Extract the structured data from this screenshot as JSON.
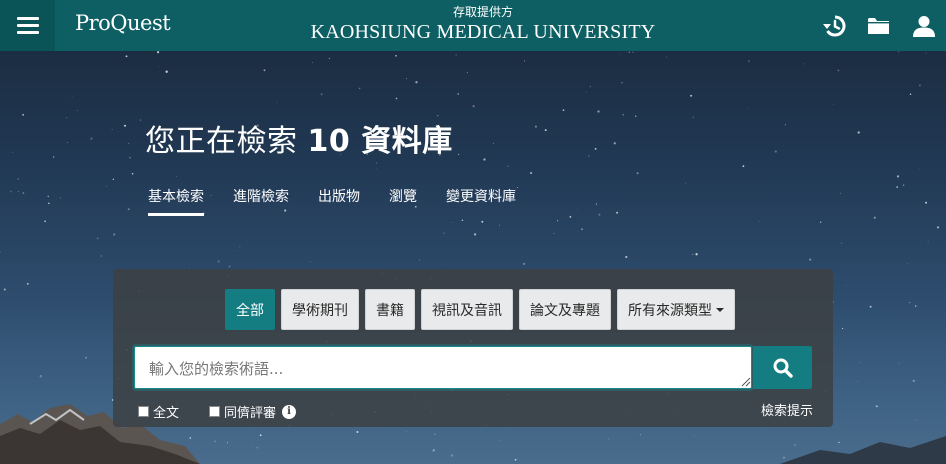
{
  "header": {
    "logo": "ProQuest",
    "provider_caption": "存取提供方",
    "provider_name": "KAOHSIUNG MEDICAL UNIVERSITY",
    "icons": [
      "menu-icon",
      "history-icon",
      "folder-icon",
      "user-icon"
    ]
  },
  "hero": {
    "title_prefix": "您正在檢索 ",
    "title_bold": "10 資料庫"
  },
  "nav": {
    "items": [
      {
        "label": "基本檢索",
        "active": true
      },
      {
        "label": "進階檢索"
      },
      {
        "label": "出版物"
      },
      {
        "label": "瀏覽"
      },
      {
        "label": "變更資料庫"
      }
    ]
  },
  "search": {
    "types": [
      {
        "label": "全部",
        "active": true
      },
      {
        "label": "學術期刊"
      },
      {
        "label": "書籍"
      },
      {
        "label": "視訊及音訊"
      },
      {
        "label": "論文及專題"
      },
      {
        "label": "所有來源類型"
      }
    ],
    "placeholder": "輸入您的檢索術語...",
    "fulltext_label": "全文",
    "peer_review_label": "同儕評審",
    "tips_label": "檢索提示",
    "search_icon": "search-icon",
    "info_icon": "info-icon"
  },
  "colors": {
    "header_bg": "#0d5f63",
    "accent": "#137d82",
    "panel_bg": "#3c4044"
  }
}
